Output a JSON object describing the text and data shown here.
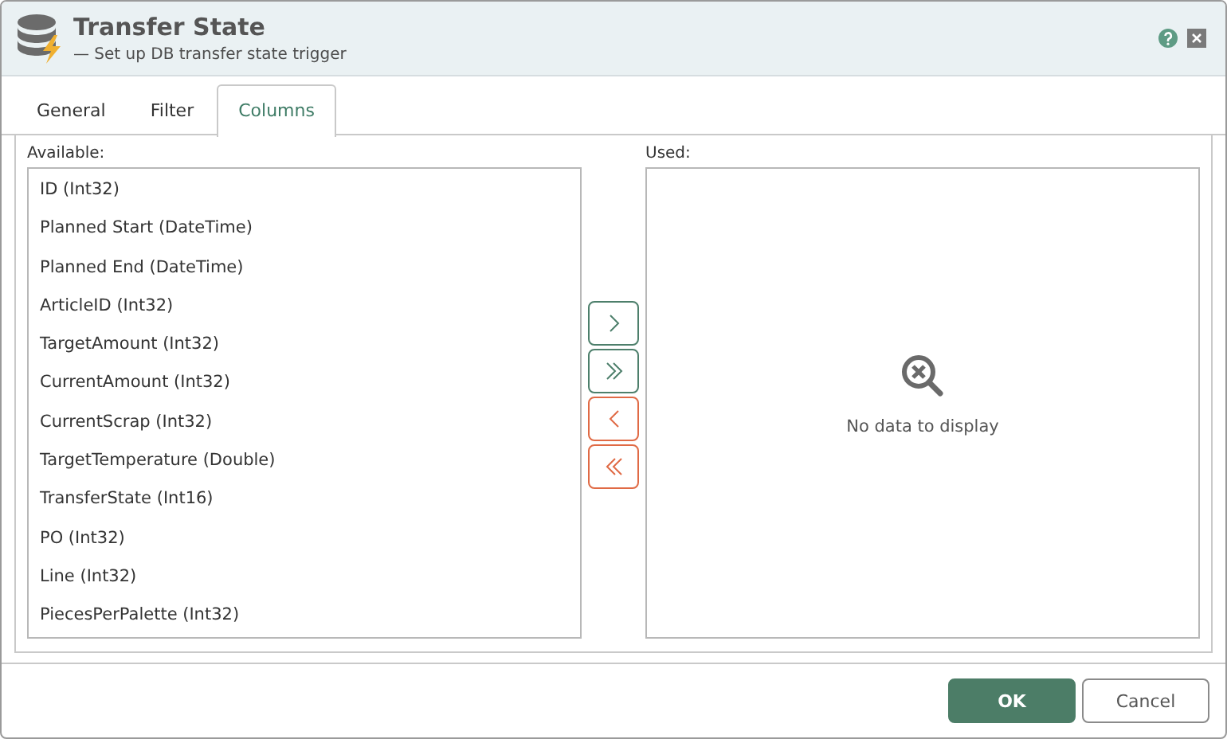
{
  "window": {
    "title": "Transfer State",
    "subtitle": "— Set up DB transfer state trigger"
  },
  "tabs": [
    {
      "label": "General",
      "selected": false
    },
    {
      "label": "Filter",
      "selected": false
    },
    {
      "label": "Columns",
      "selected": true
    }
  ],
  "available": {
    "label": "Available:",
    "items": [
      "ID (Int32)",
      "Planned Start (DateTime)",
      "Planned End (DateTime)",
      "ArticleID (Int32)",
      "TargetAmount (Int32)",
      "CurrentAmount (Int32)",
      "CurrentScrap (Int32)",
      "TargetTemperature (Double)",
      "TransferState (Int16)",
      "PO (Int32)",
      "Line (Int32)",
      "PiecesPerPalette (Int32)"
    ]
  },
  "transfer_buttons": [
    {
      "kind": "add"
    },
    {
      "kind": "add-all"
    },
    {
      "kind": "remove"
    },
    {
      "kind": "remove-all"
    }
  ],
  "used": {
    "label": "Used:",
    "empty_text": "No data to display"
  },
  "buttons": [
    {
      "label": "OK",
      "kind": "primary"
    },
    {
      "label": "Cancel",
      "kind": "secondary"
    }
  ]
}
